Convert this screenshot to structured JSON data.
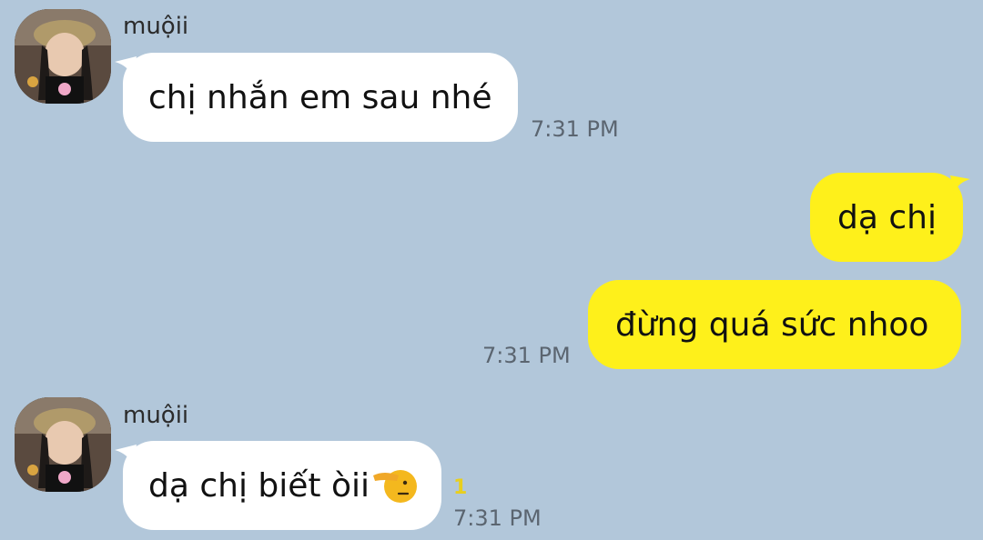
{
  "colors": {
    "background": "#b2c7da",
    "incoming_bubble": "#ffffff",
    "outgoing_bubble": "#fef01b",
    "timestamp": "#5b6570",
    "unread_count": "#e8cf1e"
  },
  "messages": [
    {
      "sender": "muộii",
      "text": "chị nhắn em sau nhé",
      "time": "7:31 PM",
      "direction": "incoming"
    },
    {
      "text": "dạ chị",
      "direction": "outgoing"
    },
    {
      "text": "đừng quá sức nhoo",
      "time": "7:31 PM",
      "direction": "outgoing"
    },
    {
      "sender": "muộii",
      "text": "dạ chị biết òii",
      "emoji": "saluting-face-icon",
      "unread": "1",
      "time": "7:31 PM",
      "direction": "incoming"
    }
  ]
}
